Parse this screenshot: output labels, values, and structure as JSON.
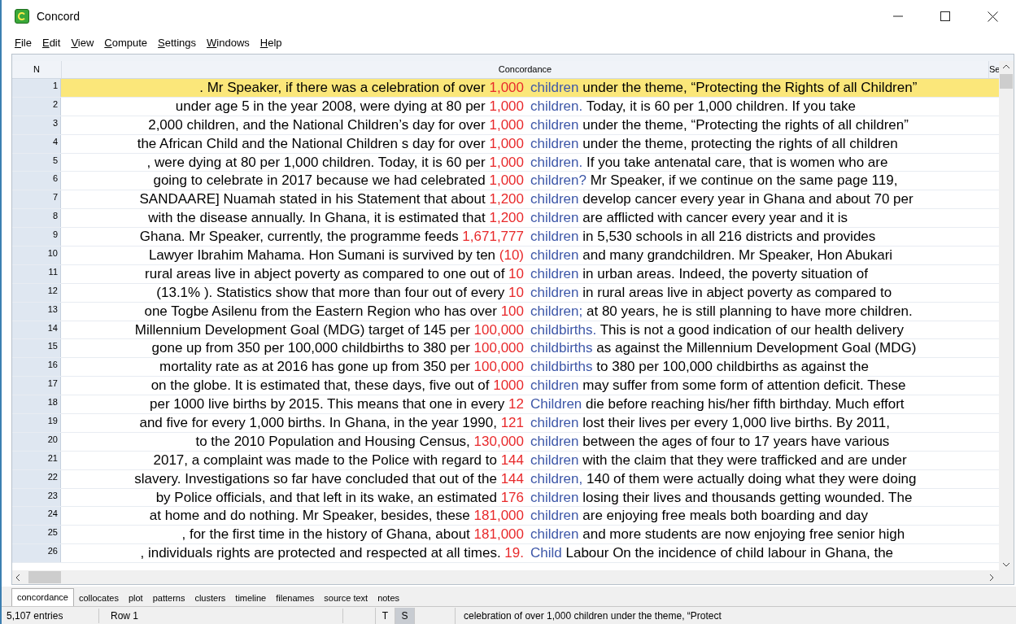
{
  "window": {
    "title": "Concord"
  },
  "menu": [
    "File",
    "Edit",
    "View",
    "Compute",
    "Settings",
    "Windows",
    "Help"
  ],
  "table": {
    "columns": [
      "N",
      "Concordance",
      "Se"
    ],
    "rows": [
      {
        "n": "1",
        "left": ". Mr Speaker, if there was a celebration of over",
        "hit": "1,000",
        "node": "children",
        "right": "under the theme, “Protecting the Rights of all Children”",
        "selected": true
      },
      {
        "n": "2",
        "left": "under age 5 in the year 2008, were dying at 80 per",
        "hit": "1,000",
        "node": "children.",
        "right": "Today, it is 60 per 1,000 children. If you take",
        "selected": false
      },
      {
        "n": "3",
        "left": "2,000 children, and the National Children’s day for over",
        "hit": "1,000",
        "node": "children",
        "right": "under the theme, “Protecting the rights of all children”",
        "selected": false
      },
      {
        "n": "4",
        "left": "the African Child and the National Children s day for over",
        "hit": "1,000",
        "node": "children",
        "right": "under the theme, protecting the rights of all children",
        "selected": false
      },
      {
        "n": "5",
        "left": ", were dying at 80 per 1,000 children. Today, it is 60 per",
        "hit": "1,000",
        "node": "children.",
        "right": "If you take antenatal care, that is women who are",
        "selected": false
      },
      {
        "n": "6",
        "left": "going to celebrate in 2017 because we had celebrated",
        "hit": "1,000",
        "node": "children?",
        "right": "Mr Speaker, if we continue on the same page 119,",
        "selected": false
      },
      {
        "n": "7",
        "left": "SANDAARE] Nuamah stated in his Statement that about",
        "hit": "1,200",
        "node": "children",
        "right": "develop cancer every year in Ghana and about 70 per",
        "selected": false
      },
      {
        "n": "8",
        "left": "with the disease annually. In Ghana, it is estimated that",
        "hit": "1,200",
        "node": "children",
        "right": "are afflicted with cancer every year and it is",
        "selected": false
      },
      {
        "n": "9",
        "left": "Ghana. Mr Speaker, currently, the programme feeds",
        "hit": "1,671,777",
        "node": "children",
        "right": "in 5,530 schools in all 216 districts and provides",
        "selected": false
      },
      {
        "n": "10",
        "left": "Lawyer Ibrahim Mahama. Hon Sumani is survived by ten",
        "hit": "(10)",
        "node": "children",
        "right": "and many grandchildren. Mr Speaker, Hon Abukari",
        "selected": false
      },
      {
        "n": "11",
        "left": "rural areas live in abject poverty as compared to one out of",
        "hit": "10",
        "node": "children",
        "right": "in urban areas. Indeed, the poverty situation of",
        "selected": false
      },
      {
        "n": "12",
        "left": "(13.1% ). Statistics show that more than four out of every",
        "hit": "10",
        "node": "children",
        "right": "in rural areas live in abject poverty as compared to",
        "selected": false
      },
      {
        "n": "13",
        "left": "one Togbe Asilenu from the Eastern Region who has over",
        "hit": "100",
        "node": "children;",
        "right": "at 80 years, he is still planning to have more children.",
        "selected": false
      },
      {
        "n": "14",
        "left": "Millennium Development Goal (MDG) target of 145 per",
        "hit": "100,000",
        "node": "childbirths.",
        "right": "This is not a good indication of our health delivery",
        "selected": false
      },
      {
        "n": "15",
        "left": "gone up from 350 per 100,000 childbirths to 380 per",
        "hit": "100,000",
        "node": "childbirths",
        "right": "as against the Millennium Development Goal (MDG)",
        "selected": false
      },
      {
        "n": "16",
        "left": "mortality rate as at 2016 has gone up from 350 per",
        "hit": "100,000",
        "node": "childbirths",
        "right": "to 380 per 100,000 childbirths as against the",
        "selected": false
      },
      {
        "n": "17",
        "left": "on the globe. It is estimated that, these days, five out of",
        "hit": "1000",
        "node": "children",
        "right": "may suffer from some form of attention deficit. These",
        "selected": false
      },
      {
        "n": "18",
        "left": "per 1000 live births by 2015. This means that one in every",
        "hit": "12",
        "node": "Children",
        "right": "die before reaching his/her fifth birthday. Much effort",
        "selected": false
      },
      {
        "n": "19",
        "left": "and five for every 1,000 births. In Ghana, in the year 1990,",
        "hit": "121",
        "node": "children",
        "right": "lost their lives per every 1,000 live births. By 2011,",
        "selected": false
      },
      {
        "n": "20",
        "left": "to the 2010 Population and Housing Census,",
        "hit": "130,000",
        "node": "children",
        "right": "between the ages of four to 17 years have various",
        "selected": false
      },
      {
        "n": "21",
        "left": "2017, a complaint was made to the Police with regard to",
        "hit": "144",
        "node": "children",
        "right": "with the claim that they were trafficked and are under",
        "selected": false
      },
      {
        "n": "22",
        "left": "slavery. Investigations so far have concluded that out of the",
        "hit": "144",
        "node": "children,",
        "right": "140 of them were actually doing what they were doing",
        "selected": false
      },
      {
        "n": "23",
        "left": "by Police officials, and that left in its wake, an estimated",
        "hit": "176",
        "node": "children",
        "right": "losing their lives and thousands getting wounded. The",
        "selected": false
      },
      {
        "n": "24",
        "left": "at home and do nothing. Mr Speaker, besides, these",
        "hit": "181,000",
        "node": "children",
        "right": "are enjoying free meals both boarding and day",
        "selected": false
      },
      {
        "n": "25",
        "left": ", for the first time in the history of Ghana, about",
        "hit": "181,000",
        "node": "children",
        "right": "and more students are now enjoying free senior high",
        "selected": false
      },
      {
        "n": "26",
        "left": ", individuals rights are protected and respected at all times.",
        "hit": "19.",
        "node": "Child",
        "right": "Labour On the incidence of child labour in Ghana, the",
        "selected": false
      }
    ]
  },
  "tabs": [
    {
      "label": "concordance",
      "selected": true
    },
    {
      "label": "collocates",
      "selected": false
    },
    {
      "label": "plot",
      "selected": false
    },
    {
      "label": "patterns",
      "selected": false
    },
    {
      "label": "clusters",
      "selected": false
    },
    {
      "label": "timeline",
      "selected": false
    },
    {
      "label": "filenames",
      "selected": false
    },
    {
      "label": "source text",
      "selected": false
    },
    {
      "label": "notes",
      "selected": false
    }
  ],
  "status_bar": {
    "entries": "5,107 entries",
    "row": "Row 1",
    "toggles": [
      {
        "label": "T",
        "pressed": false
      },
      {
        "label": "S",
        "pressed": true
      }
    ],
    "preview": "celebration of over 1,000 children under the theme, “Protect"
  }
}
